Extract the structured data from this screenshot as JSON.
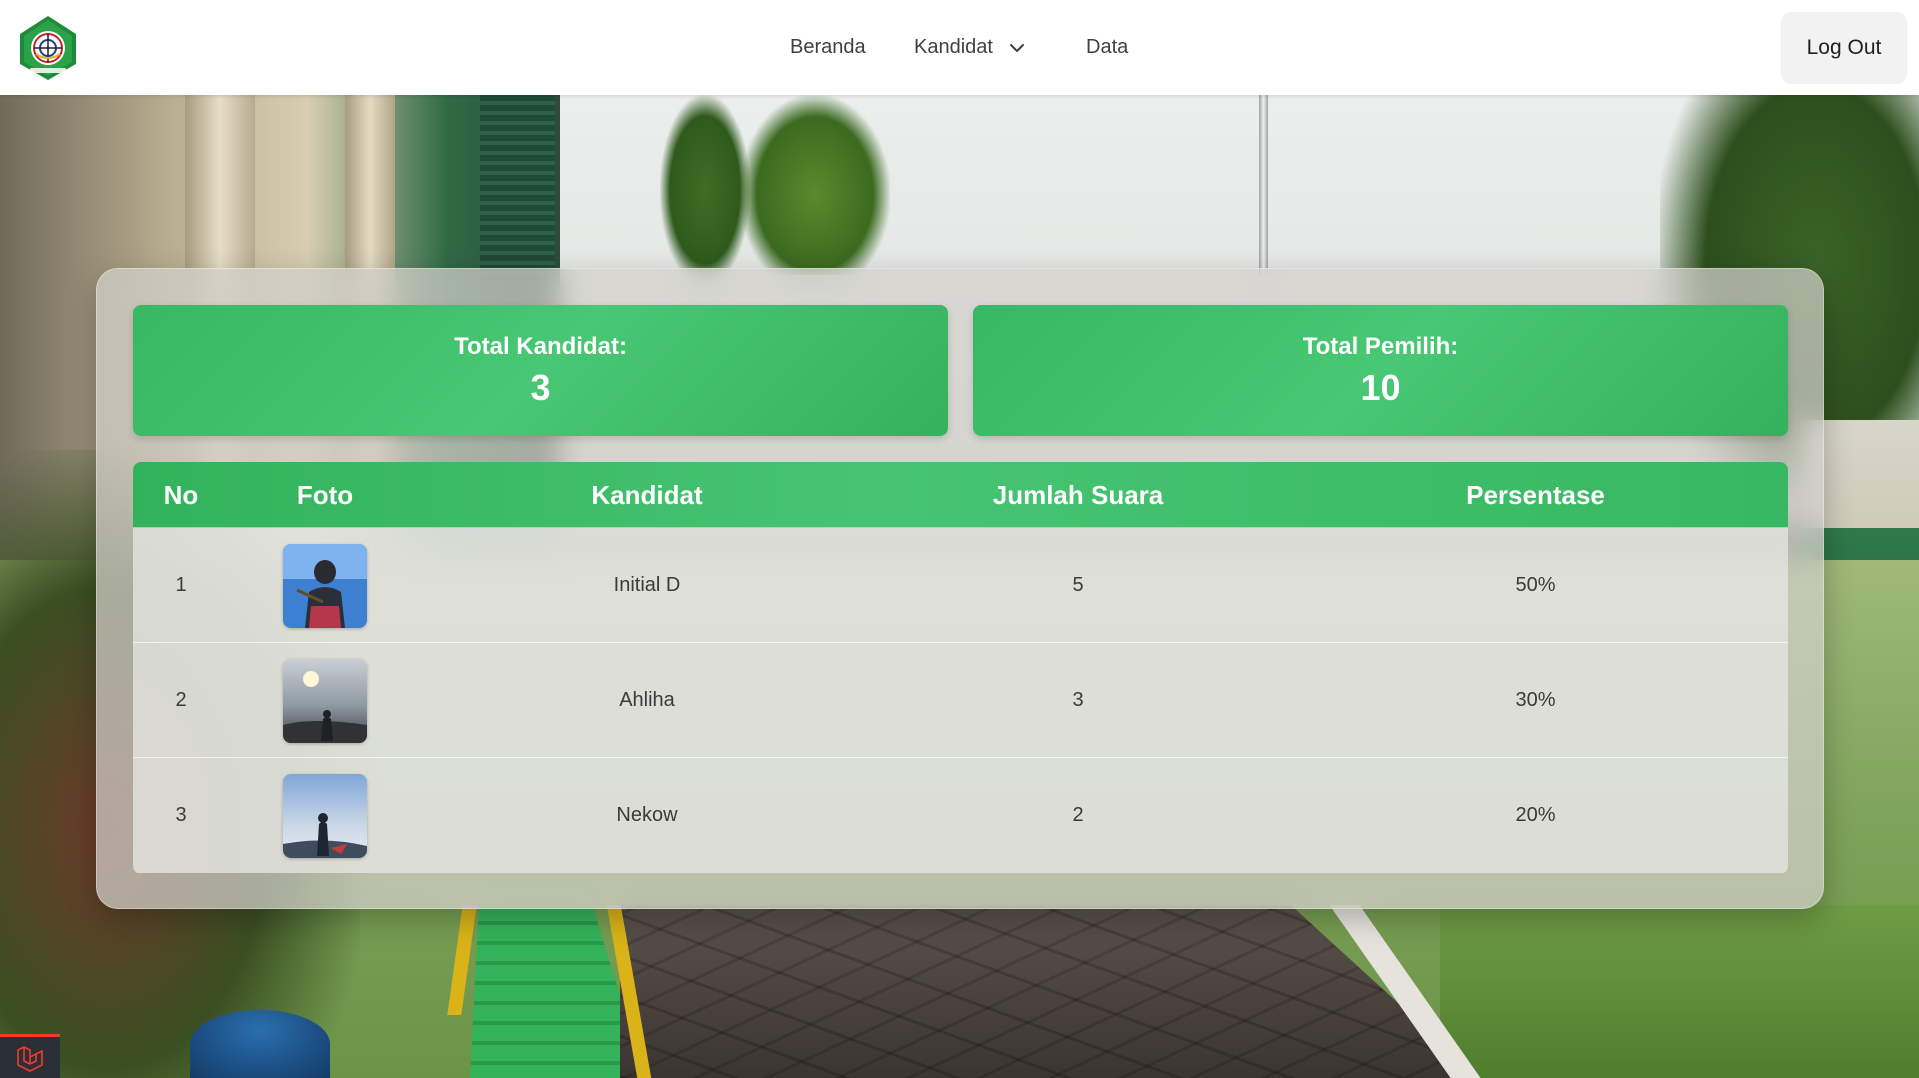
{
  "navbar": {
    "logo_icon": "school-emblem-icon",
    "links": {
      "beranda": "Beranda",
      "kandidat": "Kandidat",
      "data": "Data"
    },
    "logout_label": "Log Out"
  },
  "stats": {
    "total_kandidat_label": "Total Kandidat:",
    "total_kandidat_value": "3",
    "total_pemilih_label": "Total Pemilih:",
    "total_pemilih_value": "10"
  },
  "table": {
    "headers": {
      "no": "No",
      "foto": "Foto",
      "kandidat": "Kandidat",
      "jumlah_suara": "Jumlah Suara",
      "persentase": "Persentase"
    },
    "rows": [
      {
        "no": "1",
        "kandidat": "Initial D",
        "jumlah_suara": "5",
        "persentase": "50%"
      },
      {
        "no": "2",
        "kandidat": "Ahliha",
        "jumlah_suara": "3",
        "persentase": "30%"
      },
      {
        "no": "3",
        "kandidat": "Nekow",
        "jumlah_suara": "2",
        "persentase": "20%"
      }
    ]
  },
  "colors": {
    "accent_green": "#3dbb68",
    "navbar_bg": "#ffffff",
    "logout_bg": "#f2f2f2"
  },
  "corner_badge_icon": "laravel-logo-icon"
}
